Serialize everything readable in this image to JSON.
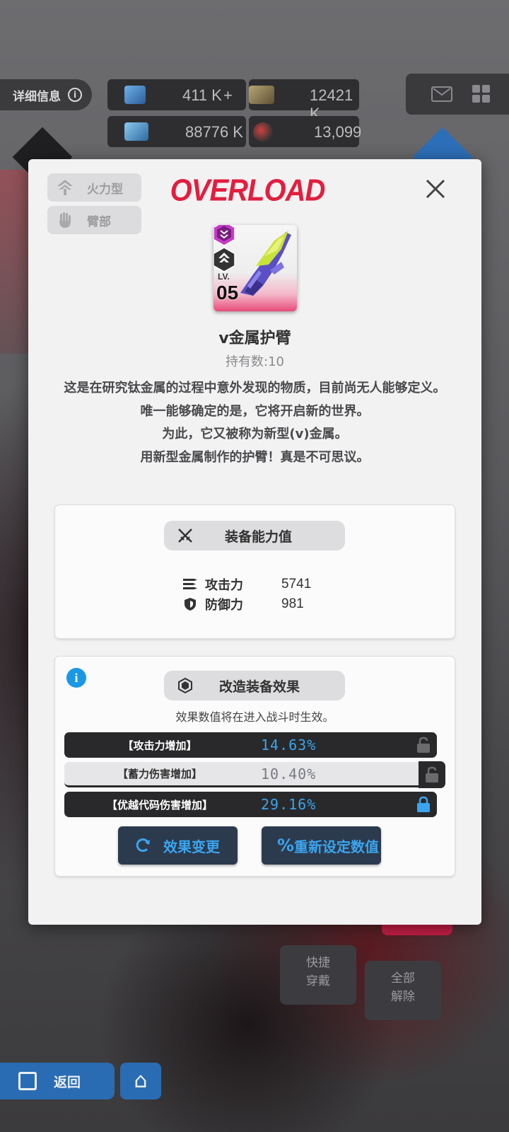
{
  "hud": {
    "detail_label": "详细信息",
    "detail_icon": "info-icon",
    "resources": [
      {
        "icon": "crystal-icon",
        "value": "411 K"
      },
      {
        "icon": "credit-card-icon",
        "value": "12421 K"
      },
      {
        "icon": "module-icon",
        "value": "88776 K"
      },
      {
        "icon": "core-orb-icon",
        "value": "13,099"
      }
    ],
    "add_symbol": "+",
    "mail_icon": "mail-icon",
    "menu_icon": "grid-icon"
  },
  "background": {
    "quick_equip": "快捷\n穿戴",
    "unequip_all": "全部\n解除",
    "back_label": "返回"
  },
  "modal": {
    "tags": [
      {
        "icon": "firepower-type-icon",
        "label": "火力型"
      },
      {
        "icon": "arm-icon",
        "label": "臂部"
      }
    ],
    "logo_text": "OVERLOAD",
    "item": {
      "name": "v金属护臂",
      "count_label": "持有数:10",
      "lv_label": "LV.",
      "level": "05",
      "description": "这是在研究钛金属的过程中意外发现的物质，目前尚无人能够定义。\n唯一能够确定的是，它将开启新的世界。\n为此，它又被称为新型(v)金属。\n用新型金属制作的护臂！真是不可思议。"
    },
    "stats_panel": {
      "title": "装备能力值",
      "stats": [
        {
          "icon": "attack-icon",
          "label": "攻击力",
          "value": "5741"
        },
        {
          "icon": "defense-shield-icon",
          "label": "防御力",
          "value": "981"
        }
      ]
    },
    "effects_panel": {
      "title": "改造装备效果",
      "note": "效果数值将在进入战斗时生效。",
      "effects": [
        {
          "name": "【攻击力增加】",
          "value": "14.63%",
          "locked": false
        },
        {
          "name": "【蓄力伤害增加】",
          "value": "10.40%",
          "locked": false
        },
        {
          "name": "【优越代码伤害增加】",
          "value": "29.16%",
          "locked": true
        }
      ],
      "change_button": "效果变更",
      "reset_button": "重新设定数值"
    },
    "colors": {
      "accent_blue": "#3aa5ef",
      "logo_red": "#e21e3f",
      "rarity_pink": "#e84b79",
      "badge_purple": "#c53cc6"
    }
  }
}
